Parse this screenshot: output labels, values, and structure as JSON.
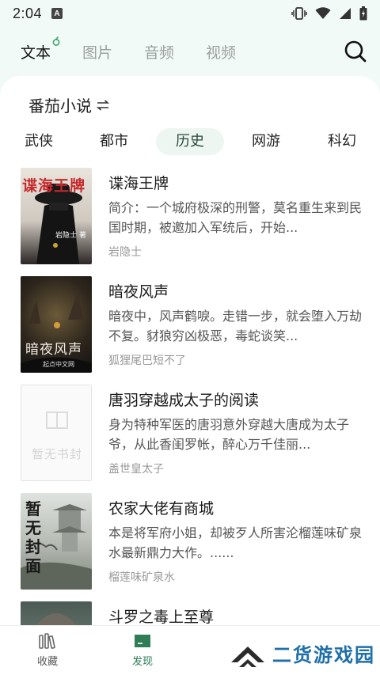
{
  "status": {
    "time": "2:04",
    "app_icon": "A"
  },
  "tabs": [
    {
      "label": "文本"
    },
    {
      "label": "图片"
    },
    {
      "label": "音频"
    },
    {
      "label": "视频"
    }
  ],
  "source": {
    "label": "番茄小说"
  },
  "categories": [
    "武侠",
    "都市",
    "历史",
    "网游",
    "科幻"
  ],
  "active_category": "历史",
  "books": [
    {
      "title": "谍海王牌",
      "desc": "简介：一个城府极深的刑警，莫名重生来到民国时期，被邀加入军统后，开始...",
      "author": "岩隐士",
      "cover_text": "谍海王牌",
      "cover_sub": "岩隐士 著"
    },
    {
      "title": "暗夜风声",
      "desc": "暗夜中，风声鹤唳。走错一步，就会堕入万劫不复。豺狼穷凶极恶，毒蛇谈笑...",
      "author": "狐狸尾巴短不了",
      "cover_text": "暗夜风声",
      "cover_sub": "起点中文网"
    },
    {
      "title": "唐羽穿越成太子的阅读",
      "desc": "身为特种军医的唐羽意外穿越大唐成为太子爷，从此香闺罗帐，醉心万千佳丽...",
      "author": "盖世皇太子",
      "cover_text": "暂无书封"
    },
    {
      "title": "农家大佬有商城",
      "desc": "本是将军府小姐，却被歹人所害沦榴莲味矿泉水最新鼎力大作。......",
      "author": "榴莲味矿泉水",
      "cover_text": "暂无封面"
    },
    {
      "title": "斗罗之毒上至尊",
      "desc": "",
      "author": ""
    }
  ],
  "bottom_nav": [
    {
      "label": "收藏",
      "icon": "bookshelf-icon"
    },
    {
      "label": "发现",
      "icon": "book-icon"
    }
  ],
  "watermark": {
    "text": "二货游戏园"
  },
  "colors": {
    "accent": "#2e7d57",
    "watermark": "#1f6fa8"
  }
}
